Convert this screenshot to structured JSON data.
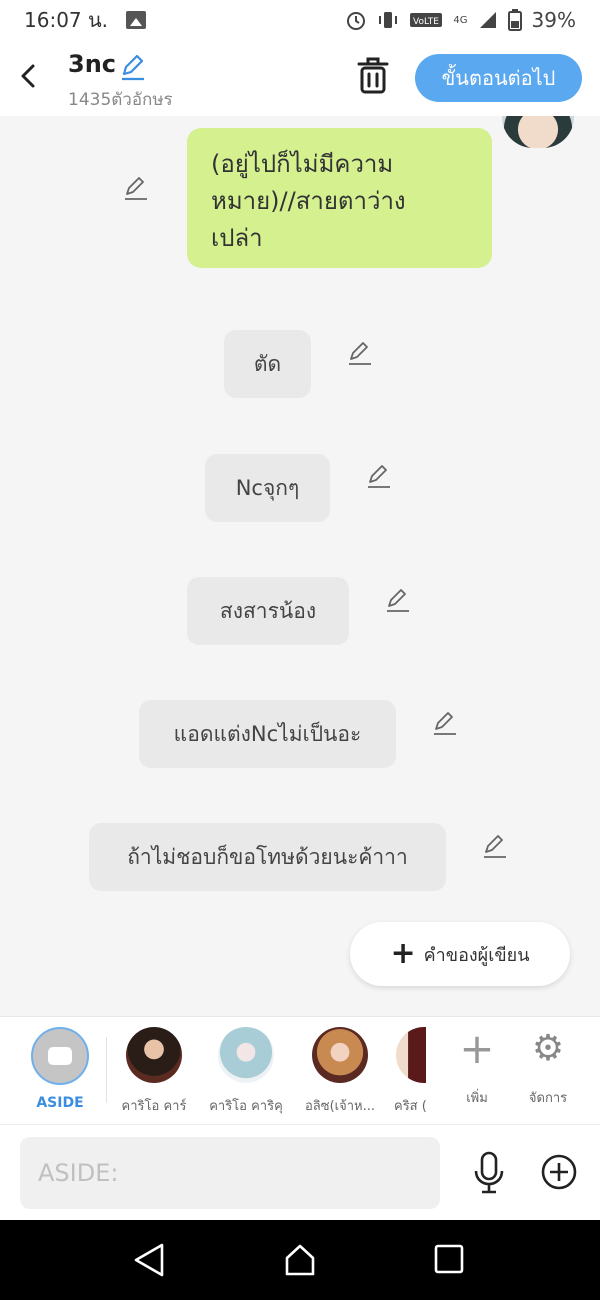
{
  "status": {
    "time": "16:07 น.",
    "network": "4G",
    "battery": "39%"
  },
  "header": {
    "title": "3nc",
    "char_count": "1435ตัวอักษร",
    "next_label": "ขั้นตอนต่อไป"
  },
  "messages": [
    {
      "text": "(อยู่ไปก็ไม่มีความหมาย)//สายตาว่างเปล่า",
      "lines": [
        "(อยู่ไปก็ไม่มีความ",
        "หมาย)//สายตาว่าง",
        "เปล่า"
      ]
    },
    {
      "text": "ตัด"
    },
    {
      "text": "Ncจุกๆ"
    },
    {
      "text": "สงสารน้อง"
    },
    {
      "text": "แอดแต่งNcไม่เป็นอะ"
    },
    {
      "text": "ถ้าไม่ชอบก็ขอโทษด้วยนะค้าาา"
    }
  ],
  "writer_button": "คำของผู้เขียน",
  "characters": {
    "aside_label": "ASIDE",
    "items": [
      {
        "name": "คาริโอ คาร์",
        "color": "#3a2a22"
      },
      {
        "name": "คาริโอ คาริคุ",
        "color": "#a8cdd6"
      },
      {
        "name": "อลิซ(เจ้าห...",
        "color": "#a65a3b"
      },
      {
        "name": "คริส (",
        "color": "#5a1a1a"
      }
    ],
    "add_label": "เพิ่ม",
    "manage_label": "จัดการ"
  },
  "input": {
    "placeholder": "ASIDE:",
    "value": ""
  }
}
